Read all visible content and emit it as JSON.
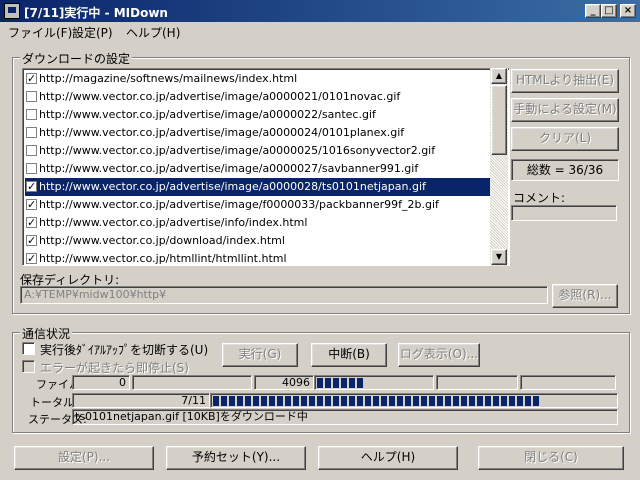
{
  "window": {
    "title": "[7/11]実行中 - MIDown"
  },
  "menu": [
    "ファイル(F)",
    "設定(P)",
    "ヘルプ(H)"
  ],
  "download_settings": {
    "group_title": "ダウンロードの設定",
    "urls": [
      {
        "checked": true,
        "url": "http://magazine/softnews/mailnews/index.html"
      },
      {
        "checked": false,
        "url": "http://www.vector.co.jp/advertise/image/a0000021/0101novac.gif"
      },
      {
        "checked": false,
        "url": "http://www.vector.co.jp/advertise/image/a0000022/santec.gif"
      },
      {
        "checked": false,
        "url": "http://www.vector.co.jp/advertise/image/a0000024/0101planex.gif"
      },
      {
        "checked": false,
        "url": "http://www.vector.co.jp/advertise/image/a0000025/1016sonyvector2.gif"
      },
      {
        "checked": false,
        "url": "http://www.vector.co.jp/advertise/image/a0000027/savbanner991.gif"
      },
      {
        "checked": true,
        "url": "http://www.vector.co.jp/advertise/image/a0000028/ts0101netjapan.gif",
        "selected": true
      },
      {
        "checked": true,
        "url": "http://www.vector.co.jp/advertise/image/f0000033/packbanner99f_2b.gif"
      },
      {
        "checked": true,
        "url": "http://www.vector.co.jp/advertise/info/index.html"
      },
      {
        "checked": true,
        "url": "http://www.vector.co.jp/download/index.html"
      },
      {
        "checked": true,
        "url": "http://www.vector.co.jp/htmllint/htmllint.html"
      }
    ],
    "buttons": {
      "html_extract": "HTMLより抽出(E)",
      "manual_settings": "手動による設定(M)",
      "clear": "クリア(L)"
    },
    "total": "総数 = 36/36",
    "comment_label": "コメント:",
    "comment_value": "",
    "save_dir_label": "保存ディレクトリ:",
    "save_dir_value": "A:¥TEMP¥midw100¥http¥",
    "browse_button": "参照(R)..."
  },
  "comm_status": {
    "group_title": "通信状況",
    "disconnect_dialup": "実行後ﾀﾞｲｱﾙｱｯﾌﾟを切断する(U)",
    "stop_on_error": "エラーが起きたら即停止(S)",
    "run_button": "実行(G)",
    "abort_button": "中断(B)",
    "log_button": "ログ表示(O)...",
    "file_label": "ファイル:",
    "file_current": "0",
    "file_size": "4096",
    "file_progress_blocks": 6,
    "total_label": "トータル:",
    "total_value": "7/11",
    "total_progress_blocks": 41,
    "status_label": "ステータス:",
    "status_text": "ts0101netjapan.gif [10KB]をダウンロード中"
  },
  "footer": {
    "settings": "設定(P)...",
    "reservation": "予約セット(Y)...",
    "help": "ヘルプ(H)",
    "close": "閉じる(C)"
  }
}
